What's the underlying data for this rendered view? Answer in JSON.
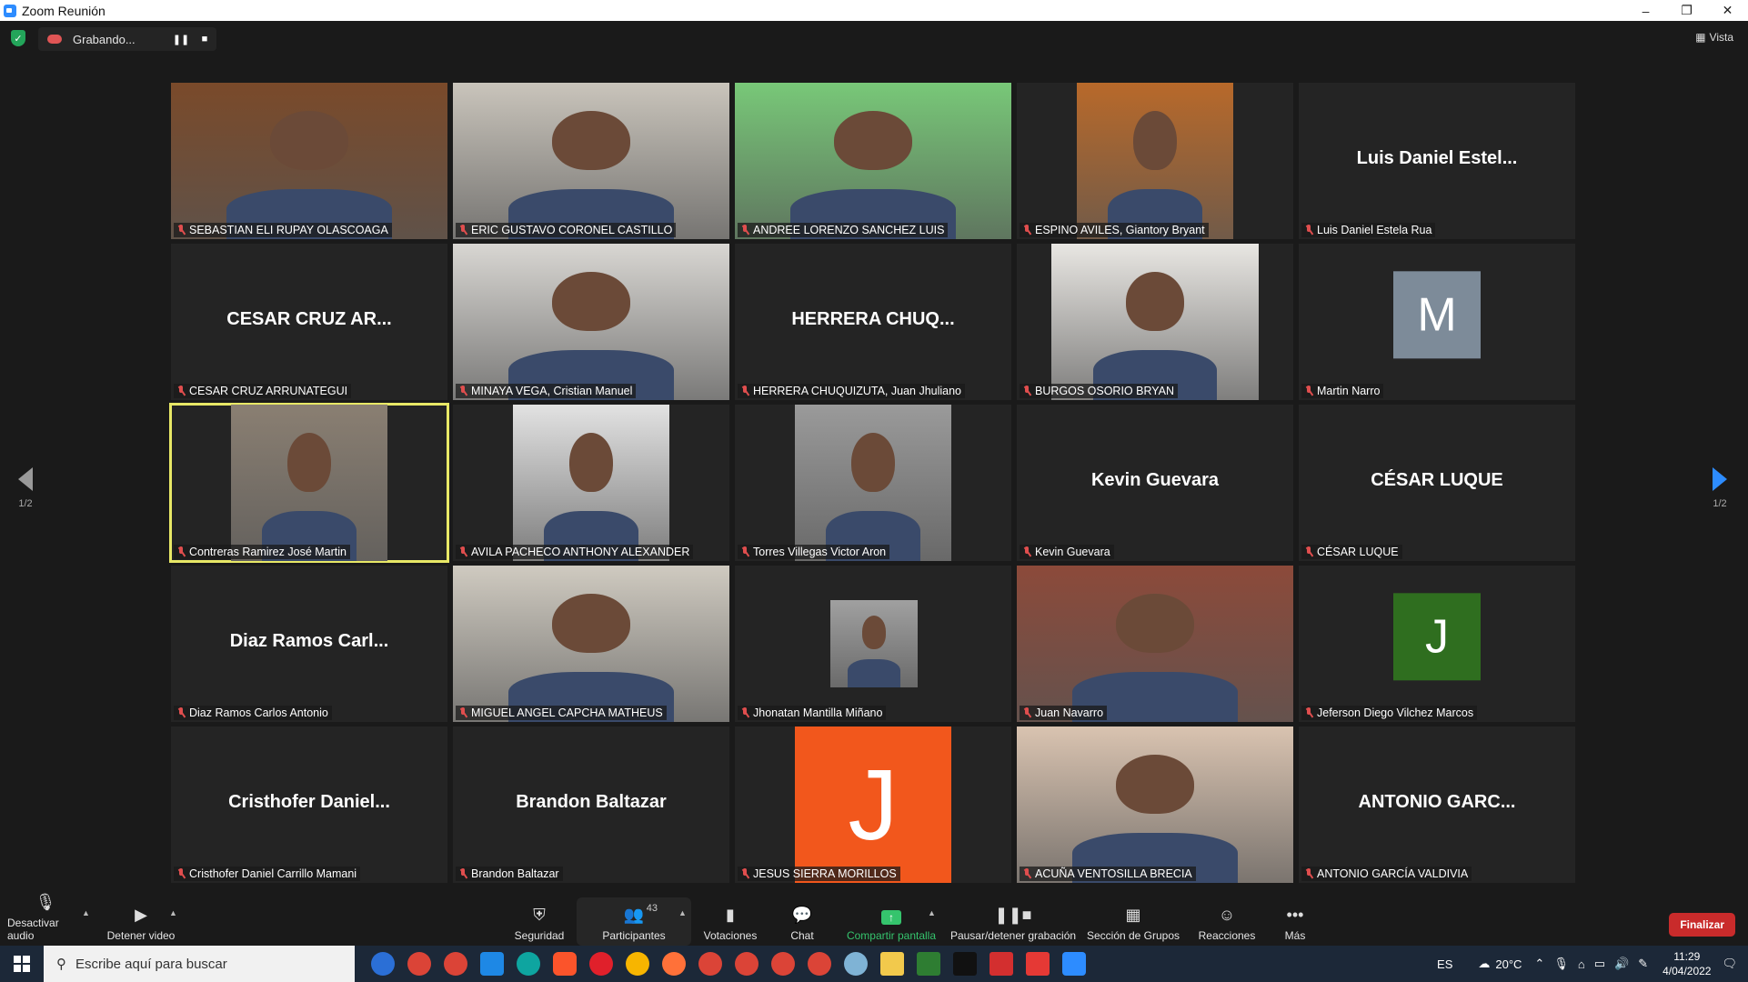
{
  "window": {
    "title": "Zoom Reunión",
    "min": "–",
    "max": "❐",
    "close": "✕"
  },
  "topbar": {
    "recording_label": "Grabando...",
    "pause_icon": "❚❚",
    "stop_icon": "■",
    "view_label": "Vista"
  },
  "pager": {
    "left": "1/2",
    "right": "1/2"
  },
  "tiles": [
    {
      "name": "SEBASTIAN ELI RUPAY OLASCOAGA",
      "kind": "video",
      "bg": "#7a4a2a"
    },
    {
      "name": "ERIC GUSTAVO CORONEL CASTILLO",
      "kind": "video",
      "bg": "#c9c4bb"
    },
    {
      "name": "ANDREE LORENZO SANCHEZ LUIS",
      "kind": "video",
      "bg": "#78c878"
    },
    {
      "name": "ESPINO AVILES, Giantory Bryant",
      "kind": "video",
      "bg": "#b8692a"
    },
    {
      "name": "Luis Daniel Estela Rua",
      "kind": "text",
      "display": "Luis Daniel Estel..."
    },
    {
      "name": "CESAR CRUZ ARRUNATEGUI",
      "kind": "text",
      "display": "CESAR CRUZ AR..."
    },
    {
      "name": "MINAYA VEGA, Cristian Manuel",
      "kind": "video",
      "bg": "#d8d6d2"
    },
    {
      "name": "HERRERA CHUQUIZUTA, Juan Jhuliano",
      "kind": "text",
      "display": "HERRERA CHUQ..."
    },
    {
      "name": "BURGOS OSORIO BRYAN",
      "kind": "video",
      "bg": "#e8e6e2"
    },
    {
      "name": "Martin Narro",
      "kind": "avatar",
      "initial": "M",
      "color": "#7d8b99"
    },
    {
      "name": "Contreras Ramirez  José Martin",
      "kind": "video",
      "bg": "#8a7f72",
      "active": true
    },
    {
      "name": "AVILA PACHECO ANTHONY ALEXANDER",
      "kind": "video",
      "bg": "#e2e2e2"
    },
    {
      "name": "Torres Villegas Victor Aron",
      "kind": "video",
      "bg": "#9a9a9a"
    },
    {
      "name": "Kevin Guevara",
      "kind": "text",
      "display": "Kevin Guevara"
    },
    {
      "name": "CÉSAR LUQUE",
      "kind": "text",
      "display": "CÉSAR LUQUE"
    },
    {
      "name": "Diaz Ramos Carlos Antonio",
      "kind": "text",
      "display": "Diaz Ramos Carl..."
    },
    {
      "name": "MIGUEL ANGEL CAPCHA MATHEUS",
      "kind": "video",
      "bg": "#cfcac0"
    },
    {
      "name": "Jhonatan Mantilla Miñano",
      "kind": "video",
      "bg": "#a0a0a0"
    },
    {
      "name": "Juan Navarro",
      "kind": "video",
      "bg": "#8c4a3a"
    },
    {
      "name": "Jeferson Diego Vilchez Marcos",
      "kind": "avatar",
      "initial": "J",
      "color": "#2f6e1f"
    },
    {
      "name": "Cristhofer Daniel Carrillo Mamani",
      "kind": "text",
      "display": "Cristhofer  Daniel..."
    },
    {
      "name": "Brandon Baltazar",
      "kind": "text",
      "display": "Brandon Baltazar"
    },
    {
      "name": "JESUS SIERRA MORILLOS",
      "kind": "avatar-big",
      "initial": "J",
      "color": "#f2571c"
    },
    {
      "name": "ACUÑA VENTOSILLA BRECIA",
      "kind": "video",
      "bg": "#d9c3b0"
    },
    {
      "name": "ANTONIO GARCÍA VALDIVIA",
      "kind": "text",
      "display": "ANTONIO  GARC..."
    }
  ],
  "toolbar": {
    "mute": "Desactivar audio",
    "video": "Detener video",
    "security": "Seguridad",
    "participants": "Participantes",
    "participants_count": "43",
    "polls": "Votaciones",
    "chat": "Chat",
    "share": "Compartir pantalla",
    "record": "Pausar/detener grabación",
    "breakout": "Sección de Grupos",
    "reactions": "Reacciones",
    "more": "Más",
    "end": "Finalizar"
  },
  "taskbar": {
    "search_placeholder": "Escribe aquí para buscar",
    "lang": "ES",
    "weather": "20°C",
    "time": "11:29",
    "date": "4/04/2022"
  }
}
